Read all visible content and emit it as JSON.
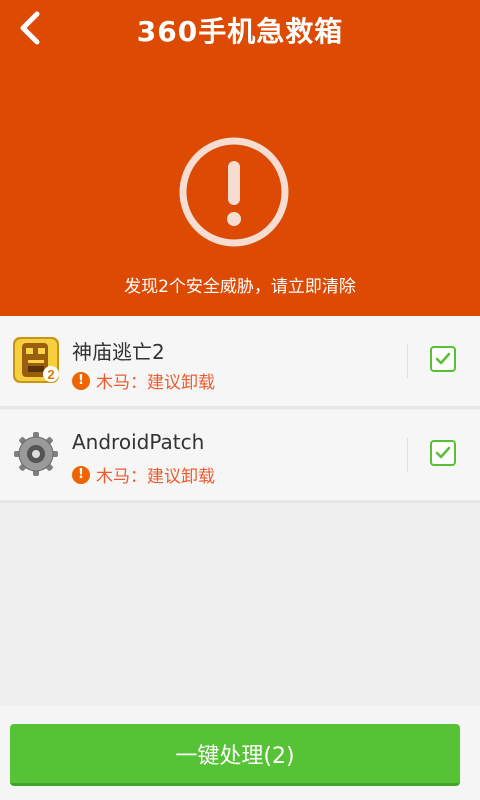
{
  "header": {
    "title": "360手机急救箱",
    "back_icon": "back-arrow-icon",
    "alert_icon": "exclamation-circle-icon",
    "message": "发现2个安全威胁，请立即清除",
    "background_color": "#dc4a04"
  },
  "threats": [
    {
      "app_name": "神庙逃亡2",
      "icon": "temple-run-2-app-icon",
      "threat_label": "木马：建议卸载",
      "checked": true
    },
    {
      "app_name": "AndroidPatch",
      "icon": "gear-app-icon",
      "threat_label": "木马：建议卸载",
      "checked": true
    }
  ],
  "action": {
    "label": "一键处理(2)",
    "color": "#55c335"
  }
}
